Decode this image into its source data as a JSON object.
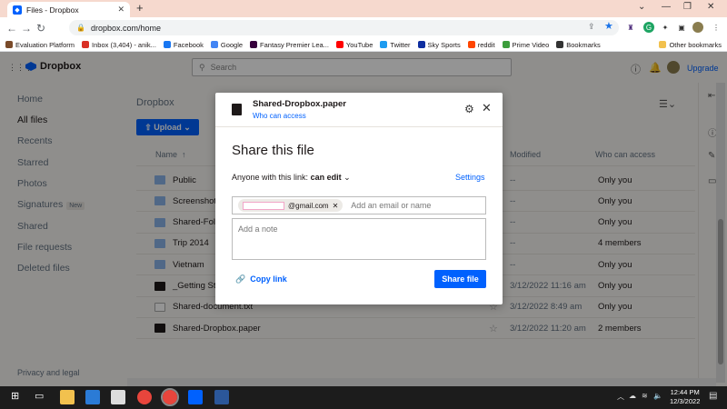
{
  "browser": {
    "tab_title": "Files - Dropbox",
    "url": "dropbox.com/home",
    "bookmarks": [
      {
        "label": "Evaluation Platform",
        "color": "#7a4b2a"
      },
      {
        "label": "Inbox (3,404) - anik...",
        "color": "#d93025"
      },
      {
        "label": "Facebook",
        "color": "#1877f2"
      },
      {
        "label": "Google",
        "color": "#4285f4"
      },
      {
        "label": "Fantasy Premier Lea...",
        "color": "#37003c"
      },
      {
        "label": "YouTube",
        "color": "#ff0000"
      },
      {
        "label": "Twitter",
        "color": "#1d9bf0"
      },
      {
        "label": "Sky Sports",
        "color": "#0e2ea0"
      },
      {
        "label": "reddit",
        "color": "#ff4500"
      },
      {
        "label": "Prime Video",
        "color": "#3c9d3c"
      },
      {
        "label": "Bookmarks",
        "color": "#333333"
      }
    ],
    "other_bookmarks": "Other bookmarks"
  },
  "app": {
    "logo": "Dropbox",
    "search_placeholder": "Search",
    "upgrade": "Upgrade",
    "sidebar": [
      {
        "label": "Home",
        "active": false
      },
      {
        "label": "All files",
        "active": true
      },
      {
        "label": "Recents",
        "active": false
      },
      {
        "label": "Starred",
        "active": false
      },
      {
        "label": "Photos",
        "active": false
      },
      {
        "label": "Signatures",
        "badge": "New",
        "active": false
      },
      {
        "label": "Shared",
        "active": false
      },
      {
        "label": "File requests",
        "active": false
      },
      {
        "label": "Deleted files",
        "active": false
      }
    ],
    "privacy": "Privacy and legal",
    "breadcrumb": "Dropbox",
    "upload_label": "Upload",
    "columns": {
      "name": "Name",
      "modified": "Modified",
      "who": "Who can access"
    },
    "rows": [
      {
        "name": "Public",
        "type": "folder",
        "modified": "--",
        "who": "Only you"
      },
      {
        "name": "Screenshots",
        "type": "folder",
        "modified": "--",
        "who": "Only you"
      },
      {
        "name": "Shared-Fold",
        "type": "folder",
        "modified": "--",
        "who": "Only you"
      },
      {
        "name": "Trip 2014",
        "type": "folder",
        "modified": "--",
        "who": "4 members"
      },
      {
        "name": "Vietnam",
        "type": "folder",
        "modified": "--",
        "who": "Only you"
      },
      {
        "name": "_Getting St",
        "type": "paper",
        "modified": "3/12/2022 11:16 am",
        "who": "Only you"
      },
      {
        "name": "Shared-document.txt",
        "type": "doc",
        "modified": "3/12/2022 8:49 am",
        "who": "Only you"
      },
      {
        "name": "Shared-Dropbox.paper",
        "type": "paper",
        "modified": "3/12/2022 11:20 am",
        "who": "2 members"
      }
    ]
  },
  "modal": {
    "file_name": "Shared-Dropbox.paper",
    "who_can_access": "Who can access",
    "title": "Share this file",
    "link_prefix": "Anyone with this link:",
    "link_permission": "can edit",
    "settings": "Settings",
    "email_chip_suffix": "@gmail.com",
    "email_placeholder": "Add an email or name",
    "note_placeholder": "Add a note",
    "copy_link": "Copy link",
    "share_button": "Share file"
  },
  "taskbar": {
    "time": "12:44 PM",
    "date": "12/3/2022"
  }
}
